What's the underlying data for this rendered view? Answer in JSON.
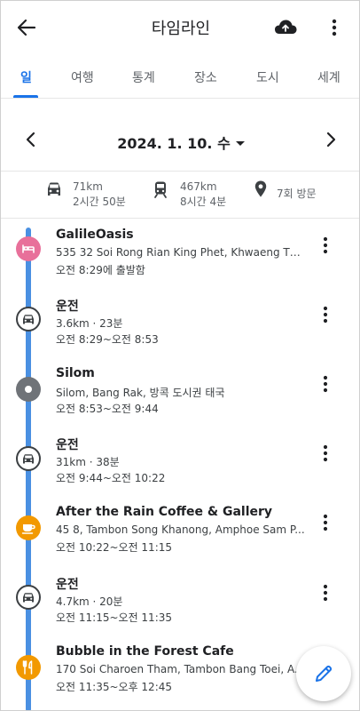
{
  "header": {
    "title": "타임라인"
  },
  "tabs": [
    {
      "label": "일",
      "active": true
    },
    {
      "label": "여행"
    },
    {
      "label": "통계"
    },
    {
      "label": "장소"
    },
    {
      "label": "도시"
    },
    {
      "label": "세계"
    }
  ],
  "date_nav": {
    "date": "2024. 1. 10. 수"
  },
  "summary": {
    "car": {
      "distance": "71km",
      "duration": "2시간 50분"
    },
    "train": {
      "distance": "467km",
      "duration": "8시간 4분"
    },
    "visits": "7회 방문"
  },
  "timeline": [
    {
      "type": "place",
      "title": "GalileOasis",
      "subtitle": "535 32 Soi Rong Rian King Phet, Khwaeng Th...",
      "time": "오전 8:29에 출발함"
    },
    {
      "type": "drive",
      "title": "운전",
      "subtitle": "3.6km · 23분",
      "time": "오전 8:29~오전 8:53"
    },
    {
      "type": "place",
      "title": "Silom",
      "subtitle": "Silom, Bang Rak, 방콕 도시권 태국",
      "time": "오전 8:53~오전 9:44"
    },
    {
      "type": "drive",
      "title": "운전",
      "subtitle": "31km · 38분",
      "time": "오전 9:44~오전 10:22"
    },
    {
      "type": "place",
      "title": "After the Rain Coffee & Gallery",
      "subtitle": "45 8, Tambon Song Khanong, Amphoe Sam P...",
      "time": "오전 10:22~오전 11:15"
    },
    {
      "type": "drive",
      "title": "운전",
      "subtitle": "4.7km · 20분",
      "time": "오전 11:15~오전 11:35"
    },
    {
      "type": "place",
      "title": "Bubble in the Forest Cafe",
      "subtitle": "170 Soi Charoen Tham, Tambon Bang Toei, A...",
      "time": "오전 11:35~오후 12:45"
    }
  ],
  "colors": {
    "accent": "#1a73e8",
    "timeline": "#4a90e2",
    "hotel": "#e8709a",
    "cafe": "#f29900",
    "place": "#6f7378"
  },
  "icons": {
    "back": "arrow-left-icon",
    "cloud": "cloud-upload-icon",
    "menu": "more-vert-icon",
    "edit": "pencil-icon"
  }
}
